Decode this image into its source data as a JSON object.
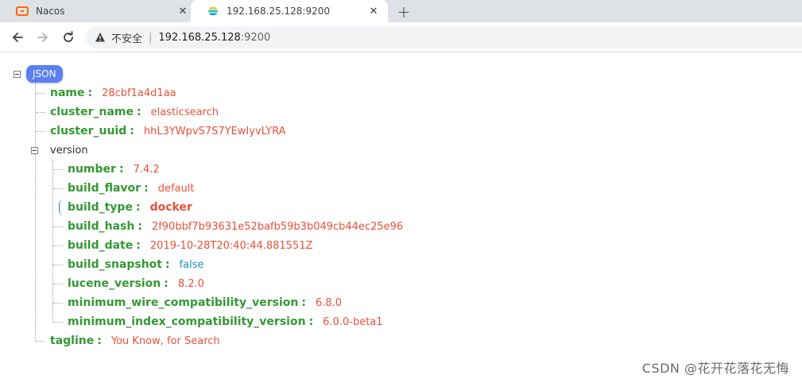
{
  "tabs": [
    {
      "title": "Nacos",
      "icon": "nacos-icon",
      "active": false
    },
    {
      "title": "192.168.25.128:9200",
      "icon": "elastic-icon",
      "active": true
    }
  ],
  "toolbar": {
    "insecure_label": "不安全",
    "url_host": "192.168.25.128",
    "url_port": ":9200"
  },
  "json_view": {
    "root_label": "JSON",
    "name_key": "name",
    "name_val": "28cbf1a4d1aa",
    "cluster_name_key": "cluster_name",
    "cluster_name_val": "elasticsearch",
    "cluster_uuid_key": "cluster_uuid",
    "cluster_uuid_val": "hhL3YWpvS7S7YEwIyvLYRA",
    "version_key": "version",
    "version": {
      "number_key": "number",
      "number_val": "7.4.2",
      "build_flavor_key": "build_flavor",
      "build_flavor_val": "default",
      "build_type_key": "build_type",
      "build_type_val": "docker",
      "build_hash_key": "build_hash",
      "build_hash_val": "2f90bbf7b93631e52bafb59b3b049cb44ec25e96",
      "build_date_key": "build_date",
      "build_date_val": "2019-10-28T20:40:44.881551Z",
      "build_snapshot_key": "build_snapshot",
      "build_snapshot_val": "false",
      "lucene_version_key": "lucene_version",
      "lucene_version_val": "8.2.0",
      "min_wire_key": "minimum_wire_compatibility_version",
      "min_wire_val": "6.8.0",
      "min_index_key": "minimum_index_compatibility_version",
      "min_index_val": "6.0.0-beta1"
    },
    "tagline_key": "tagline",
    "tagline_val": "You Know, for Search"
  },
  "watermark": "CSDN @花开花落花无悔",
  "colors": {
    "key": "#339933",
    "string": "#e8513a",
    "boolean": "#1a8fbf",
    "badge": "#5b7ff0"
  }
}
